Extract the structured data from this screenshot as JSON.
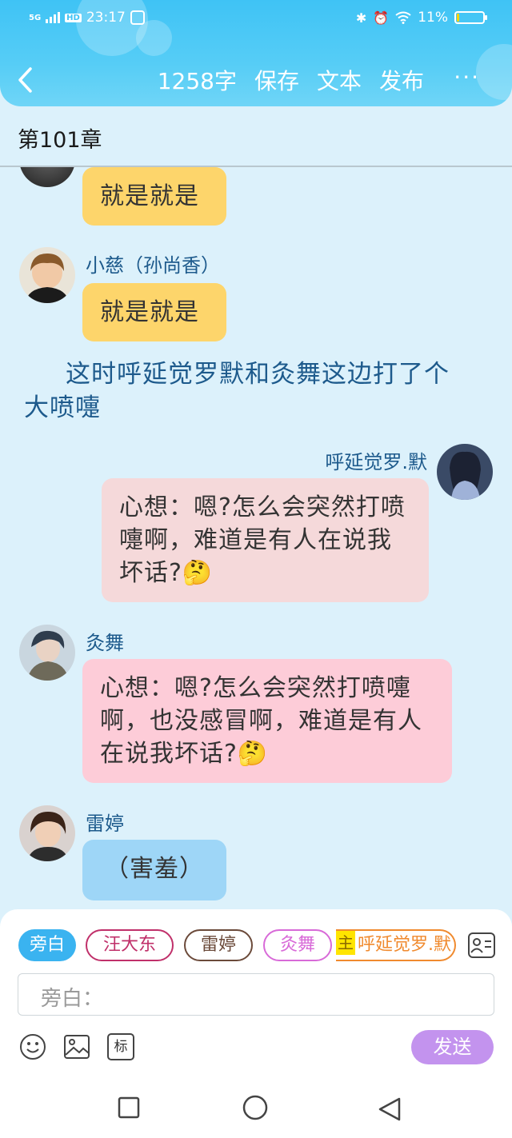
{
  "status_bar": {
    "network": "5G",
    "hd": "HD",
    "time": "23:17",
    "battery_percent": "11%",
    "battery_level": 0.11
  },
  "toolbar": {
    "back_icon": "chevron-left-icon",
    "word_count": "1258字",
    "save": "保存",
    "text": "文本",
    "publish": "发布",
    "more": "···"
  },
  "chapter": {
    "title": "第101章"
  },
  "messages": [
    {
      "speaker": "",
      "text": "就是就是",
      "color": "#fdd56b"
    },
    {
      "speaker": "小慈（孙尚香）",
      "text": "就是就是",
      "color": "#fdd56b"
    },
    {
      "narration": "这时呼延觉罗默和灸舞这边打了个大喷嚏"
    },
    {
      "speaker": "呼延觉罗.默",
      "text": "心想：嗯?怎么会突然打喷嚏啊，难道是有人在说我坏话?🤔",
      "color": "#f5d9da"
    },
    {
      "speaker": "灸舞",
      "text": "心想：嗯?怎么会突然打喷嚏啊，也没感冒啊，难道是有人在说我坏话?🤔",
      "color": "#fdccd8"
    },
    {
      "speaker": "雷婷",
      "text": "（害羞）",
      "color": "#9ed6f7"
    }
  ],
  "roles": [
    {
      "label": "旁白",
      "selected": true,
      "color": "#3ab3f0"
    },
    {
      "label": "汪大东",
      "color": "#c0306a"
    },
    {
      "label": "雷婷",
      "color": "#6b4a3a"
    },
    {
      "label": "灸舞",
      "color": "#d86ad8"
    },
    {
      "label": "呼延觉罗.默",
      "badge": "主",
      "color": "#f08a2e"
    }
  ],
  "input": {
    "placeholder": "旁白："
  },
  "tools": {
    "emoji_icon": "emoji-icon",
    "image_icon": "image-icon",
    "mark_label": "标"
  },
  "send": {
    "label": "发送"
  },
  "colors": {
    "accent": "#3fc3f5",
    "background": "#dcf1fb",
    "send": "#c393ee"
  }
}
